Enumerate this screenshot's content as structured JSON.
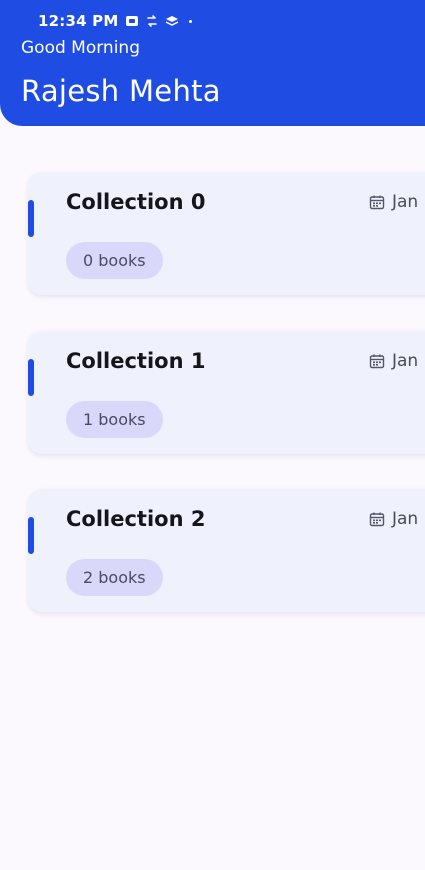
{
  "status_bar": {
    "time": "12:34 PM",
    "icons": [
      "screen-record-icon",
      "sync-icon",
      "layers-icon",
      "dot-icon"
    ]
  },
  "header": {
    "greeting": "Good Morning",
    "user_name": "Rajesh Mehta"
  },
  "collections": [
    {
      "title": "Collection 0",
      "date": "Jan",
      "badge": "0 books"
    },
    {
      "title": "Collection 1",
      "date": "Jan",
      "badge": "1 books"
    },
    {
      "title": "Collection 2",
      "date": "Jan",
      "badge": "2 books"
    }
  ],
  "colors": {
    "primary": "#1f4de4",
    "card_background": "#eff1fd",
    "badge_background": "#d9d8fa",
    "page_background": "#fbf8fe"
  }
}
